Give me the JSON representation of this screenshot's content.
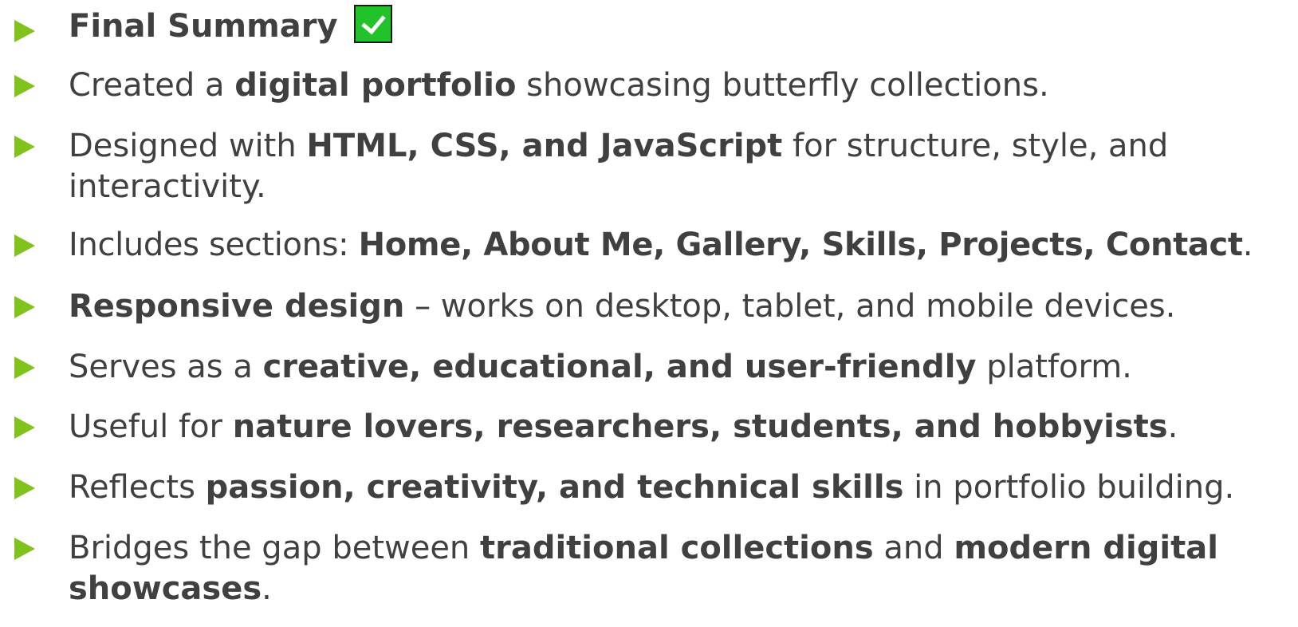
{
  "items": [
    {
      "segments": [
        {
          "t": "Final Summary",
          "b": true
        }
      ],
      "icon": "checkmark-box-icon"
    },
    {
      "segments": [
        {
          "t": "Created a "
        },
        {
          "t": "digital portfolio",
          "b": true
        },
        {
          "t": " showcasing butterfly collections."
        }
      ]
    },
    {
      "segments": [
        {
          "t": "Designed with "
        },
        {
          "t": "HTML, CSS, and JavaScript",
          "b": true
        },
        {
          "t": " for structure, style, and"
        }
      ],
      "line2": [
        {
          "t": "interactivity."
        }
      ]
    },
    {
      "segments": [
        {
          "t": "Includes sections: "
        },
        {
          "t": "Home, About Me, Gallery, Skills, Projects, Contact",
          "b": true
        },
        {
          "t": "."
        }
      ]
    },
    {
      "segments": [
        {
          "t": "Responsive design",
          "b": true
        },
        {
          "t": " – works on desktop, tablet, and mobile devices."
        }
      ]
    },
    {
      "segments": [
        {
          "t": "Serves as a "
        },
        {
          "t": "creative, educational, and user-friendly",
          "b": true
        },
        {
          "t": " platform."
        }
      ]
    },
    {
      "segments": [
        {
          "t": "Useful for "
        },
        {
          "t": "nature lovers, researchers, students, and hobbyists",
          "b": true
        },
        {
          "t": "."
        }
      ]
    },
    {
      "segments": [
        {
          "t": "Reflects "
        },
        {
          "t": "passion, creativity, and technical skills",
          "b": true
        },
        {
          "t": " in portfolio building."
        }
      ]
    },
    {
      "segments": [
        {
          "t": "Bridges the gap between "
        },
        {
          "t": "traditional collections",
          "b": true
        },
        {
          "t": " and "
        },
        {
          "t": "modern digital",
          "b": true
        }
      ],
      "line2": [
        {
          "t": "showcases",
          "b": true
        },
        {
          "t": "."
        }
      ]
    }
  ],
  "colors": {
    "bullet": "#7fc31c",
    "text": "#404040",
    "check_fill": "#22c32a"
  }
}
